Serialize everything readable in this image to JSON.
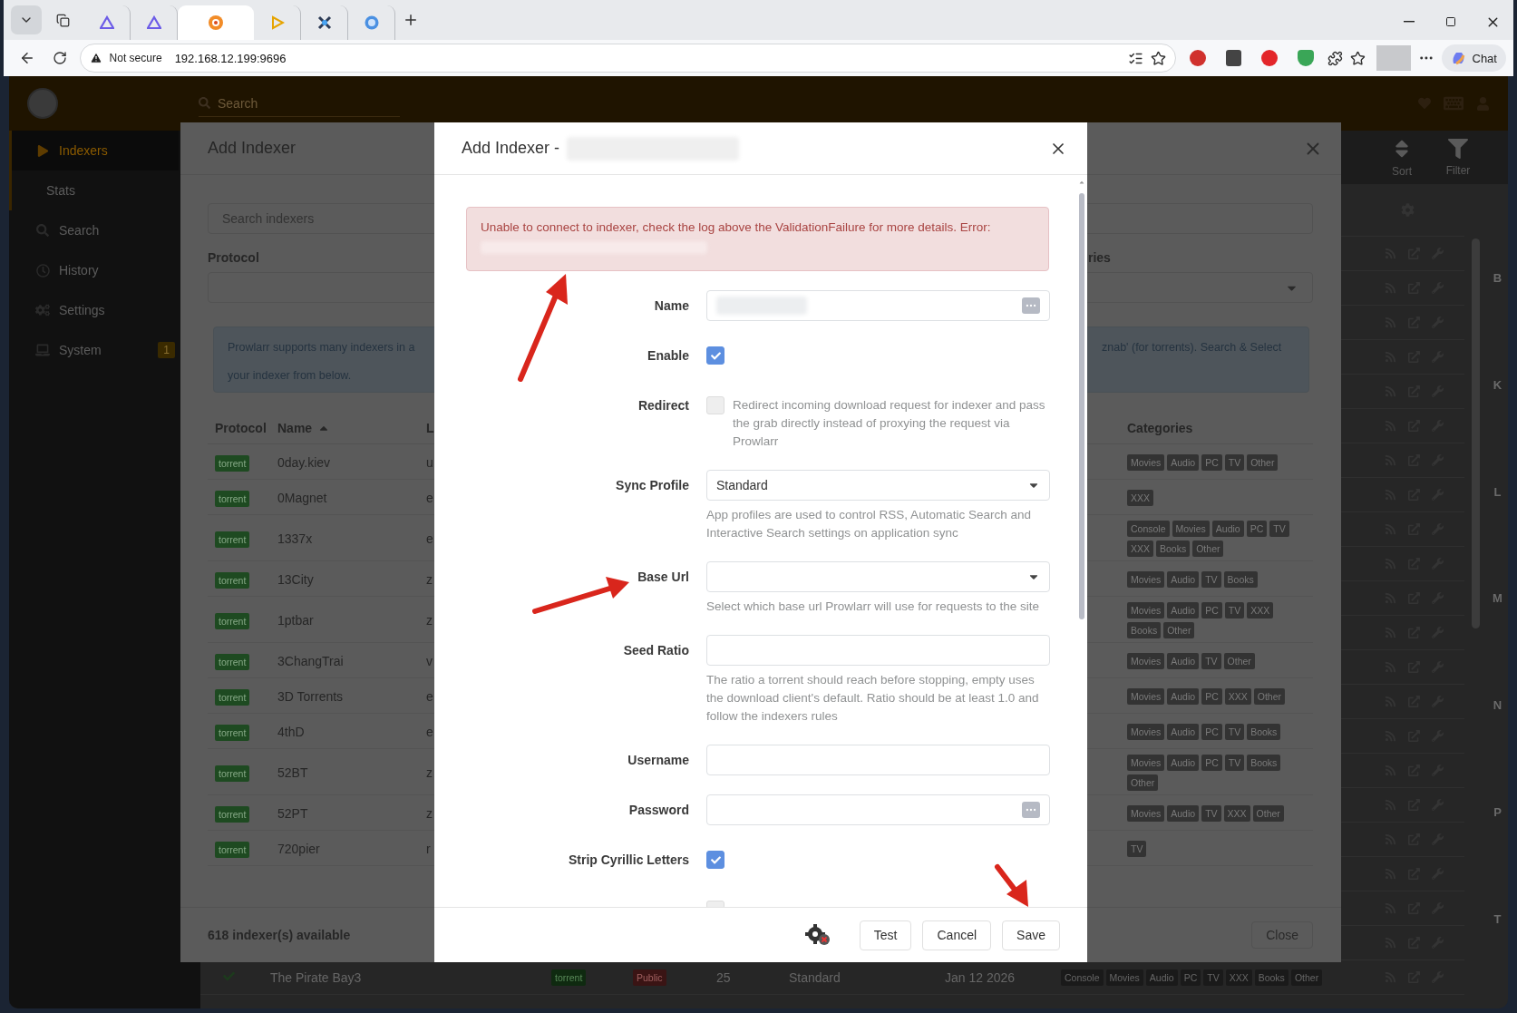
{
  "browser": {
    "tabs": [
      {
        "kind": "triangle",
        "selected": false
      },
      {
        "kind": "triangle",
        "selected": false
      },
      {
        "kind": "flame",
        "selected": true
      },
      {
        "kind": "play",
        "selected": false
      },
      {
        "kind": "cross",
        "selected": false
      },
      {
        "kind": "disc",
        "selected": false
      }
    ],
    "security": "Not secure",
    "url": "192.168.12.199:9696",
    "chat": "Chat"
  },
  "app": {
    "search_placeholder": "Search",
    "sidebar": [
      {
        "label": "Indexers",
        "kind": "main",
        "selected": true
      },
      {
        "label": "Stats",
        "kind": "sub",
        "selected": false
      },
      {
        "label": "Search",
        "kind": "main",
        "selected": false
      },
      {
        "label": "History",
        "kind": "main",
        "selected": false
      },
      {
        "label": "Settings",
        "kind": "main",
        "selected": false
      },
      {
        "label": "System",
        "kind": "main",
        "selected": false,
        "badge": "1"
      }
    ],
    "toolbar": [
      {
        "label": "Sort"
      },
      {
        "label": "Filter"
      }
    ],
    "jump_letters": [
      "B",
      "K",
      "L",
      "M",
      "N",
      "P",
      "T"
    ],
    "visible_row": {
      "enabled": true,
      "name": "The Pirate Bay3",
      "protocol": "torrent",
      "privacy": "Public",
      "priority": "25",
      "sync_profile": "Standard",
      "added": "Jan 12 2026",
      "categories": [
        "Console",
        "Movies",
        "Audio",
        "PC",
        "TV",
        "XXX",
        "Books",
        "Other"
      ]
    }
  },
  "add_indexer": {
    "title": "Add Indexer",
    "search_placeholder": "Search indexers",
    "protocol_label": "Protocol",
    "categories_label": "ries",
    "info_left": "Prowlarr supports many indexers in a",
    "info_left_2": "your indexer from below.",
    "info_right": "znab' (for torrents). Search & Select",
    "columns": [
      {
        "label": "Protocol",
        "sorted": false
      },
      {
        "label": "Name",
        "sorted": true
      },
      {
        "label": "L",
        "sorted": false
      },
      {
        "label": "Categories",
        "sorted": false
      }
    ],
    "rows": [
      {
        "protocol": "torrent",
        "name": "0day.kiev",
        "column_3": "u",
        "categories": [
          "Movies",
          "Audio",
          "PC",
          "TV",
          "Other"
        ]
      },
      {
        "protocol": "torrent",
        "name": "0Magnet",
        "column_3": "e",
        "categories": [
          "XXX"
        ]
      },
      {
        "protocol": "torrent",
        "name": "1337x",
        "column_3": "e",
        "categories": [
          "Console",
          "Movies",
          "Audio",
          "PC",
          "TV",
          "XXX",
          "Books",
          "Other"
        ]
      },
      {
        "protocol": "torrent",
        "name": "13City",
        "column_3": "z",
        "categories": [
          "Movies",
          "Audio",
          "TV",
          "Books"
        ]
      },
      {
        "protocol": "torrent",
        "name": "1ptbar",
        "column_3": "z",
        "categories": [
          "Movies",
          "Audio",
          "PC",
          "TV",
          "XXX",
          "Books",
          "Other"
        ]
      },
      {
        "protocol": "torrent",
        "name": "3ChangTrai",
        "column_3": "v",
        "categories": [
          "Movies",
          "Audio",
          "TV",
          "Other"
        ]
      },
      {
        "protocol": "torrent",
        "name": "3D Torrents",
        "column_3": "e",
        "categories": [
          "Movies",
          "Audio",
          "PC",
          "XXX",
          "Other"
        ]
      },
      {
        "protocol": "torrent",
        "name": "4thD",
        "column_3": "e",
        "categories": [
          "Movies",
          "Audio",
          "PC",
          "TV",
          "Books"
        ]
      },
      {
        "protocol": "torrent",
        "name": "52BT",
        "column_3": "z",
        "categories": [
          "Movies",
          "Audio",
          "PC",
          "TV",
          "Books",
          "Other"
        ]
      },
      {
        "protocol": "torrent",
        "name": "52PT",
        "column_3": "z",
        "categories": [
          "Movies",
          "Audio",
          "TV",
          "XXX",
          "Other"
        ]
      },
      {
        "protocol": "torrent",
        "name": "720pier",
        "column_3": "r",
        "categories": [
          "TV"
        ]
      }
    ],
    "count": "618 indexer(s) available",
    "close": "Close"
  },
  "dialog": {
    "title": "Add Indexer -",
    "title_redacted": true,
    "alert": "Unable to connect to indexer, check the log above the ValidationFailure for more details. Error:",
    "alert_redacted": true,
    "fields": [
      {
        "kind": "secret",
        "label": "Name",
        "redacted": true
      },
      {
        "kind": "checkbox",
        "label": "Enable",
        "checked": true
      },
      {
        "kind": "checkbox",
        "label": "Redirect",
        "checked": false,
        "help": "Redirect incoming download request for indexer and pass the grab directly instead of proxying the request via Prowlarr"
      },
      {
        "kind": "select",
        "label": "Sync Profile",
        "value": "Standard",
        "help": "App profiles are used to control RSS, Automatic Search and Interactive Search settings on application sync"
      },
      {
        "kind": "select",
        "label": "Base Url",
        "help": "Select which base url Prowlarr will use for requests to the site"
      },
      {
        "kind": "text",
        "label": "Seed Ratio",
        "help": "The ratio a torrent should reach before stopping, empty uses the download client's default. Ratio should be at least 1.0 and follow the indexers rules"
      },
      {
        "kind": "text",
        "label": "Username"
      },
      {
        "kind": "secret",
        "label": "Password",
        "redacted": false
      },
      {
        "kind": "checkbox",
        "label": "Strip Cyrillic Letters",
        "checked": true
      },
      {
        "kind": "checkbox",
        "checked": false
      }
    ],
    "buttons": [
      "Test",
      "Cancel",
      "Save"
    ]
  }
}
